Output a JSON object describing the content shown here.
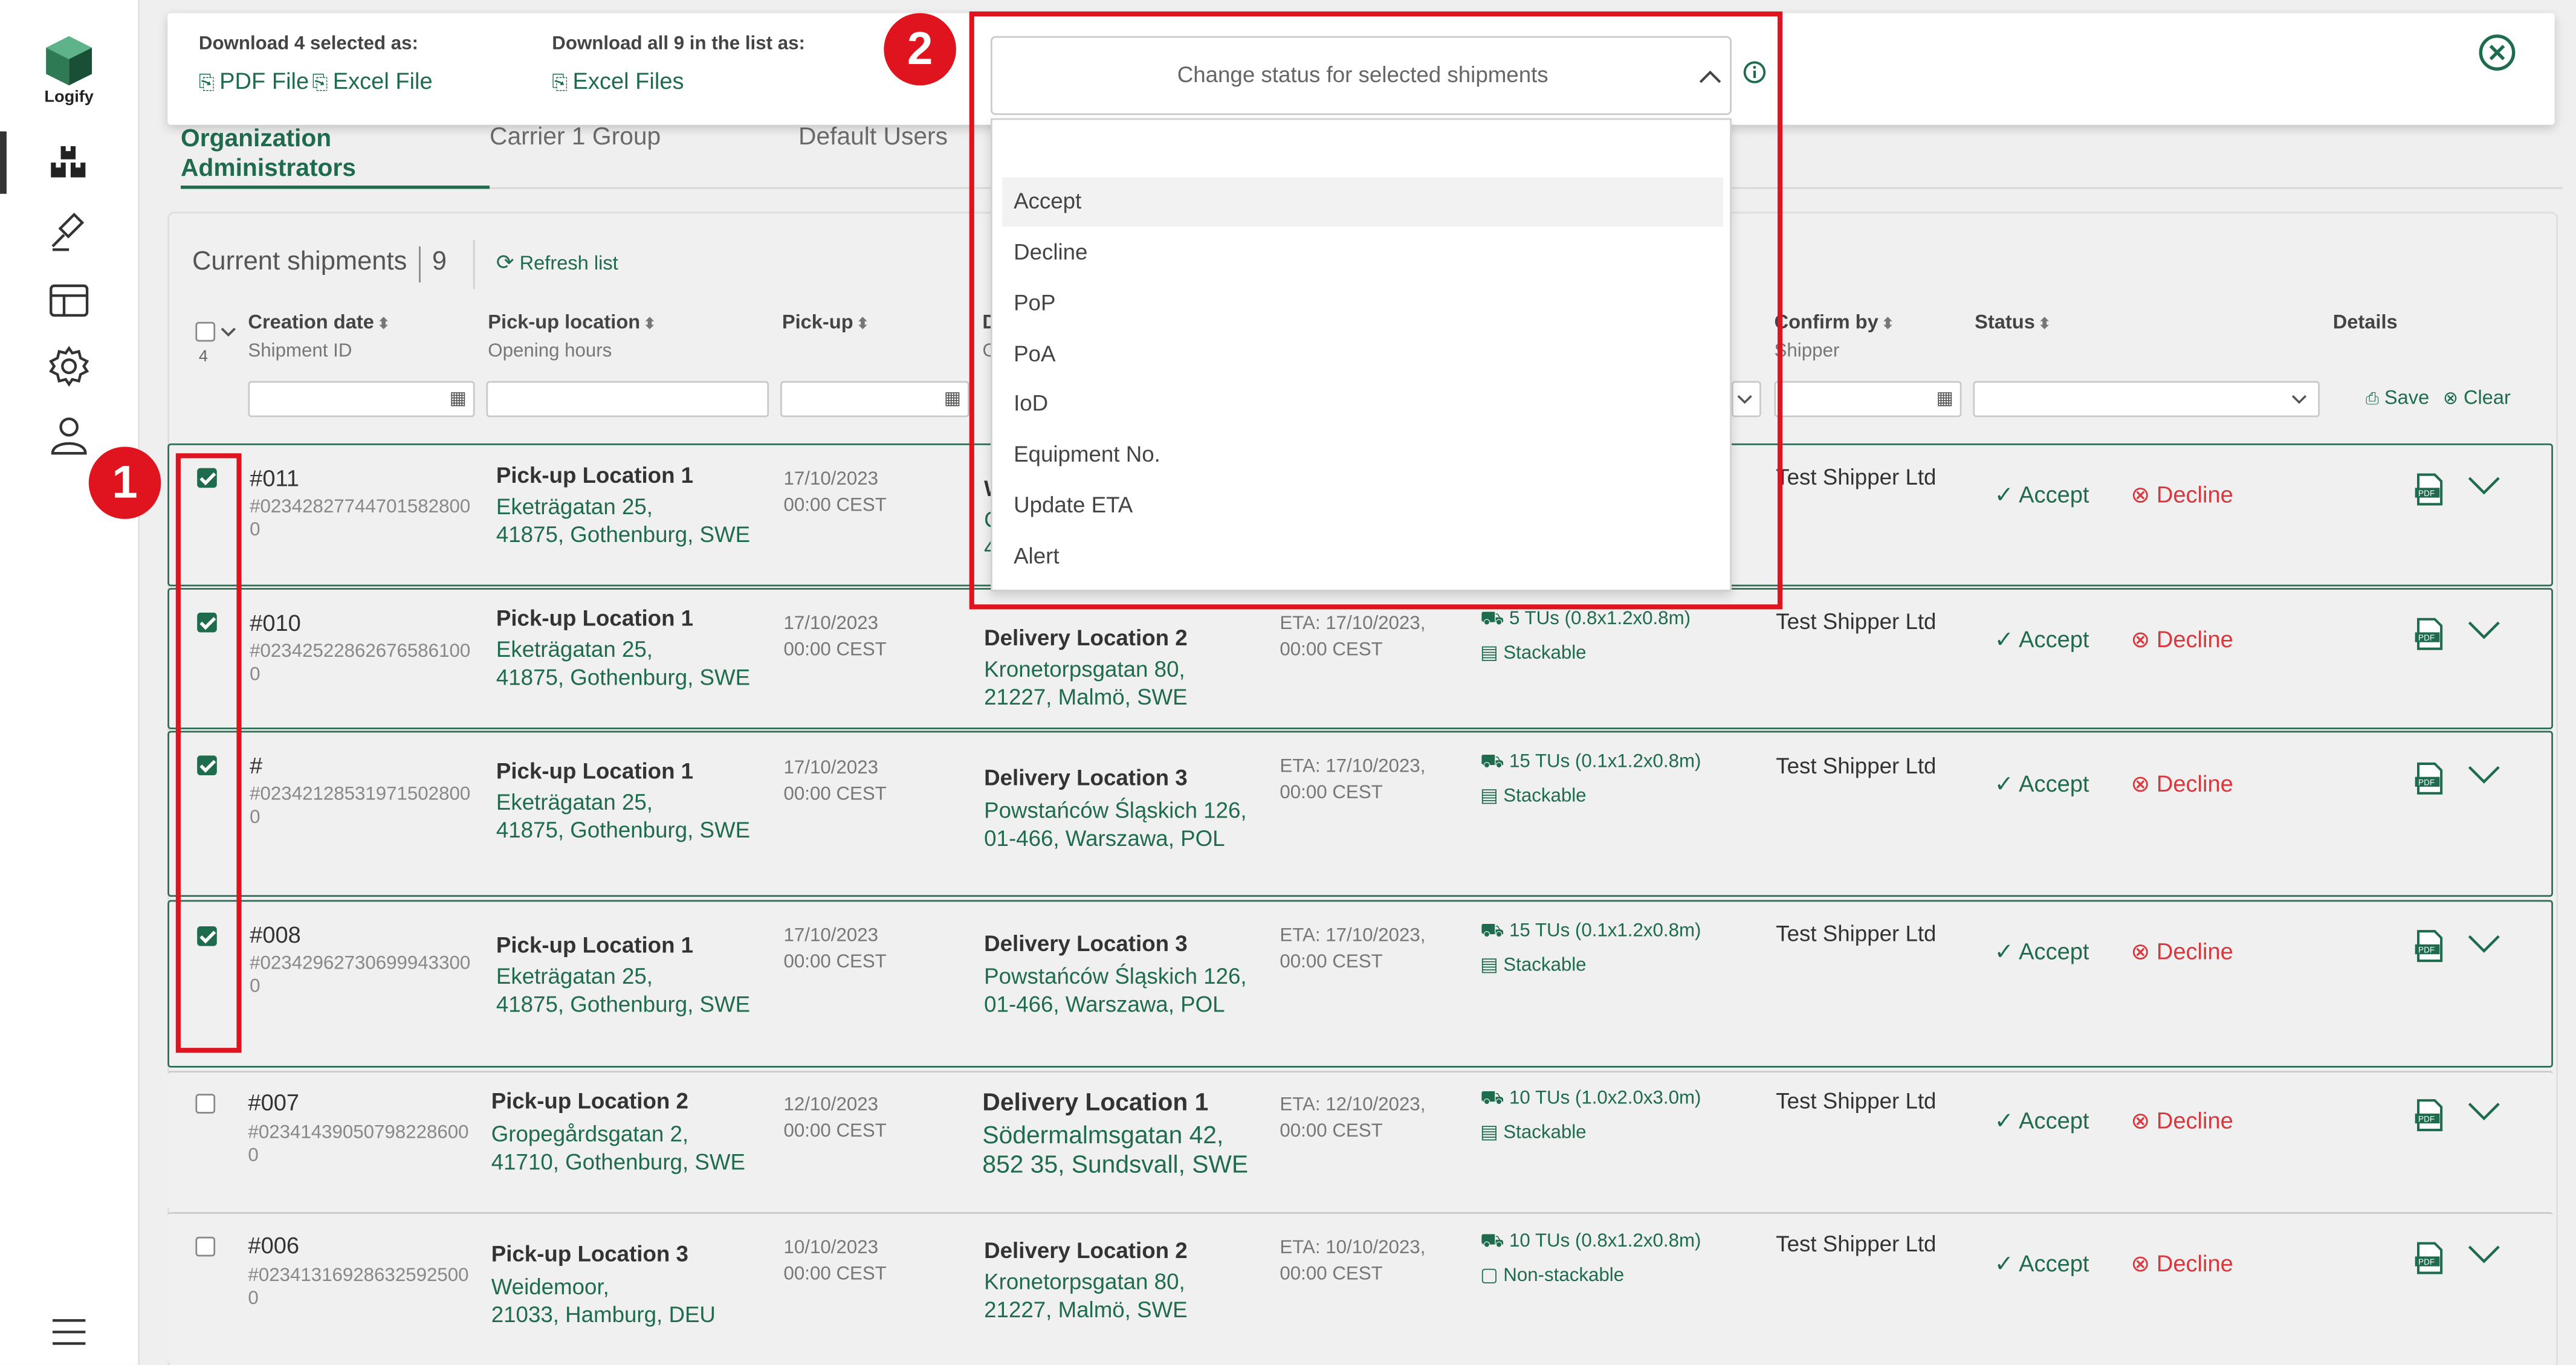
{
  "app": {
    "name": "Logify"
  },
  "download": {
    "selected_title": "Download 4 selected as:",
    "all_title": "Download all 9 in the list as:",
    "pdf_label": "PDF File",
    "excel_label": "Excel File",
    "excel_files_label": "Excel Files"
  },
  "status_dropdown": {
    "placeholder": "Change status for selected shipments",
    "options": [
      "Accept",
      "Decline",
      "PoP",
      "PoA",
      "IoD",
      "Equipment No.",
      "Update ETA",
      "Alert"
    ]
  },
  "tabs": [
    {
      "label_line1": "Organization",
      "label_line2": "Administrators"
    },
    {
      "label": "Carrier 1 Group"
    },
    {
      "label": "Default Users"
    }
  ],
  "list": {
    "title": "Current shipments",
    "count": "9",
    "refresh_label": "Refresh list",
    "select_count": "4",
    "save_label": "Save",
    "clear_label": "Clear"
  },
  "columns": {
    "creation_date": "Creation date",
    "shipment_id": "Shipment ID",
    "pickup_location": "Pick-up location",
    "opening_hours": "Opening hours",
    "pickup": "Pick-up",
    "delivery_partial": "D",
    "delivery_sub_partial": "C",
    "confirm_by": "Confirm by",
    "confirm_sub": "Shipper",
    "status": "Status",
    "details": "Details"
  },
  "actions": {
    "accept": "Accept",
    "decline": "Decline"
  },
  "rows": [
    {
      "id": "#011",
      "long_id": "#023428277447015828000",
      "pickup_name": "Pick-up Location 1",
      "pickup_addr1": "Eketrägatan 25,",
      "pickup_addr2": "41875, Gothenburg, SWE",
      "pickup_date": "17/10/2023",
      "pickup_time": "00:00 CEST",
      "delivery_name": "W",
      "delivery_addr1": "C",
      "delivery_addr2": "4",
      "eta_date": "",
      "eta_time": "",
      "tu": "",
      "stack": "",
      "shipper": "Test Shipper Ltd",
      "checked": true
    },
    {
      "id": "#010",
      "long_id": "#023425228626765861000",
      "pickup_name": "Pick-up Location 1",
      "pickup_addr1": "Eketrägatan 25,",
      "pickup_addr2": "41875, Gothenburg, SWE",
      "pickup_date": "17/10/2023",
      "pickup_time": "00:00 CEST",
      "delivery_name": "Delivery Location 2",
      "delivery_addr1": "Kronetorpsgatan 80,",
      "delivery_addr2": "21227, Malmö, SWE",
      "eta_date": "ETA:  17/10/2023,",
      "eta_time": "00:00 CEST",
      "tu": "5 TUs (0.8x1.2x0.8m)",
      "stack": "Stackable",
      "shipper": "Test Shipper Ltd",
      "checked": true
    },
    {
      "id": "#",
      "long_id": "#023421285319715028000",
      "pickup_name": "Pick-up Location 1",
      "pickup_addr1": "Eketrägatan 25,",
      "pickup_addr2": "41875, Gothenburg, SWE",
      "pickup_date": "17/10/2023",
      "pickup_time": "00:00 CEST",
      "delivery_name": "Delivery Location 3",
      "delivery_addr1": "Powstańców Śląskich 126,",
      "delivery_addr2": "01-466, Warszawa, POL",
      "eta_date": "ETA:  17/10/2023,",
      "eta_time": "00:00 CEST",
      "tu": "15 TUs (0.1x1.2x0.8m)",
      "stack": "Stackable",
      "shipper": "Test Shipper Ltd",
      "checked": true
    },
    {
      "id": "#008",
      "long_id": "#023429627306999433000",
      "pickup_name": "Pick-up Location 1",
      "pickup_addr1": "Eketrägatan 25,",
      "pickup_addr2": "41875, Gothenburg, SWE",
      "pickup_date": "17/10/2023",
      "pickup_time": "00:00 CEST",
      "delivery_name": "Delivery Location 3",
      "delivery_addr1": "Powstańców Śląskich 126,",
      "delivery_addr2": "01-466, Warszawa, POL",
      "eta_date": "ETA:  17/10/2023,",
      "eta_time": "00:00 CEST",
      "tu": "15 TUs (0.1x1.2x0.8m)",
      "stack": "Stackable",
      "shipper": "Test Shipper Ltd",
      "checked": true
    },
    {
      "id": "#007",
      "long_id": "#023414390507982286000",
      "pickup_name": "Pick-up Location 2",
      "pickup_addr1": "Gropegårdsgatan 2,",
      "pickup_addr2": "41710, Gothenburg, SWE",
      "pickup_date": "12/10/2023",
      "pickup_time": "00:00 CEST",
      "delivery_name": "Delivery Location 1",
      "delivery_addr1": "Södermalmsgatan 42,",
      "delivery_addr2": "852 35, Sundsvall, SWE",
      "eta_date": "ETA:  12/10/2023,",
      "eta_time": "00:00 CEST",
      "tu": "10 TUs (1.0x2.0x3.0m)",
      "stack": "Stackable",
      "shipper": "Test Shipper Ltd",
      "checked": false
    },
    {
      "id": "#006",
      "long_id": "#023413169286325925000",
      "pickup_name": "Pick-up Location 3",
      "pickup_addr1": "Weidemoor,",
      "pickup_addr2": "21033, Hamburg, DEU",
      "pickup_date": "10/10/2023",
      "pickup_time": "00:00 CEST",
      "delivery_name": "Delivery Location 2",
      "delivery_addr1": "Kronetorpsgatan 80,",
      "delivery_addr2": "21227, Malmö, SWE",
      "eta_date": "ETA:  10/10/2023,",
      "eta_time": "00:00 CEST",
      "tu": "10 TUs (0.8x1.2x0.8m)",
      "stack": "Non-stackable",
      "shipper": "Test Shipper Ltd",
      "checked": false
    }
  ],
  "annotations": {
    "marker1": "1",
    "marker2": "2"
  },
  "colors": {
    "brand_green": "#1f6b4d",
    "decline_red": "#d9373b",
    "annotation_red": "#e0141e"
  }
}
